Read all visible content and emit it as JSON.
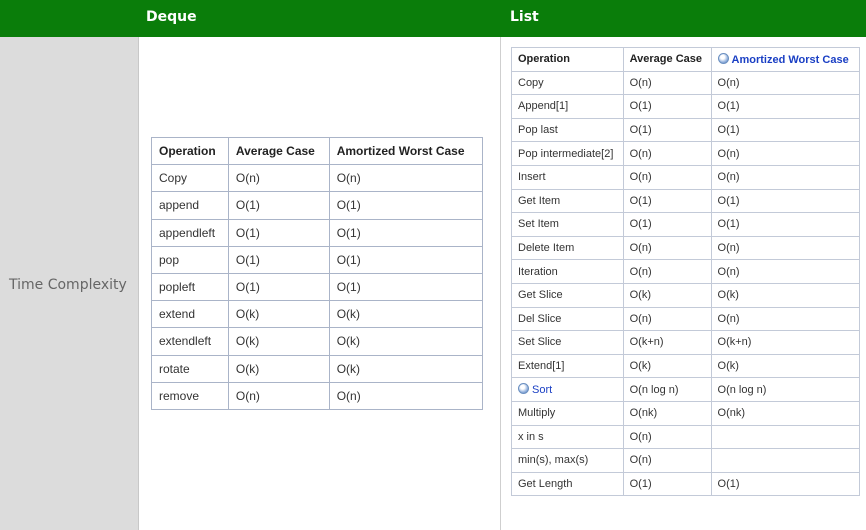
{
  "header": {
    "deque_title": "Deque",
    "list_title": "List"
  },
  "row_label": "Time Complexity",
  "deque_table": {
    "columns": [
      "Operation",
      "Average Case",
      "Amortized Worst Case"
    ],
    "rows": [
      [
        "Copy",
        "O(n)",
        "O(n)"
      ],
      [
        "append",
        "O(1)",
        "O(1)"
      ],
      [
        "appendleft",
        "O(1)",
        "O(1)"
      ],
      [
        "pop",
        "O(1)",
        "O(1)"
      ],
      [
        "popleft",
        "O(1)",
        "O(1)"
      ],
      [
        "extend",
        "O(k)",
        "O(k)"
      ],
      [
        "extendleft",
        "O(k)",
        "O(k)"
      ],
      [
        "rotate",
        "O(k)",
        "O(k)"
      ],
      [
        "remove",
        "O(n)",
        "O(n)"
      ]
    ]
  },
  "list_table": {
    "columns": [
      "Operation",
      "Average Case",
      "Amortized Worst Case"
    ],
    "rows": [
      [
        "Copy",
        "O(n)",
        "O(n)"
      ],
      [
        "Append[1]",
        "O(1)",
        "O(1)"
      ],
      [
        "Pop last",
        "O(1)",
        "O(1)"
      ],
      [
        "Pop intermediate[2]",
        "O(n)",
        "O(n)"
      ],
      [
        "Insert",
        "O(n)",
        "O(n)"
      ],
      [
        "Get Item",
        "O(1)",
        "O(1)"
      ],
      [
        "Set Item",
        "O(1)",
        "O(1)"
      ],
      [
        "Delete Item",
        "O(n)",
        "O(n)"
      ],
      [
        "Iteration",
        "O(n)",
        "O(n)"
      ],
      [
        "Get Slice",
        "O(k)",
        "O(k)"
      ],
      [
        "Del Slice",
        "O(n)",
        "O(n)"
      ],
      [
        "Set Slice",
        "O(k+n)",
        "O(k+n)"
      ],
      [
        "Extend[1]",
        "O(k)",
        "O(k)"
      ],
      [
        "Sort",
        "O(n log n)",
        "O(n log n)"
      ],
      [
        "Multiply",
        "O(nk)",
        "O(nk)"
      ],
      [
        "x in s",
        "O(n)",
        ""
      ],
      [
        "min(s), max(s)",
        "O(n)",
        ""
      ],
      [
        "Get Length",
        "O(1)",
        "O(1)"
      ]
    ]
  }
}
